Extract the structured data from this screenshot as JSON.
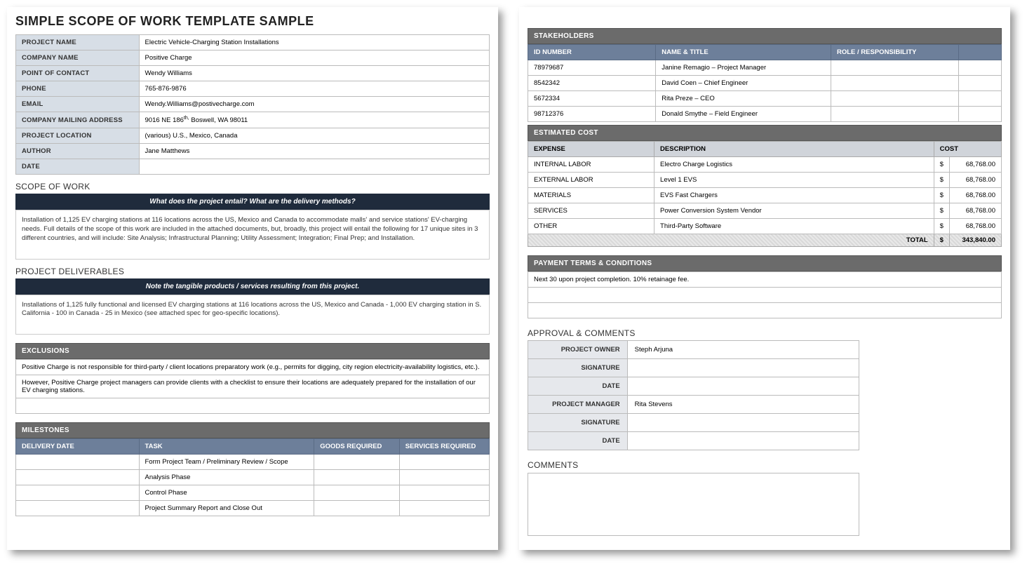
{
  "title": "SIMPLE SCOPE OF WORK TEMPLATE SAMPLE",
  "info": {
    "project_name_label": "PROJECT NAME",
    "project_name": "Electric Vehicle-Charging Station Installations",
    "company_name_label": "COMPANY NAME",
    "company_name": "Positive Charge",
    "poc_label": "POINT OF CONTACT",
    "poc": "Wendy Williams",
    "phone_label": "PHONE",
    "phone": "765-876-9876",
    "email_label": "EMAIL",
    "email": "Wendy.Williams@postivecharge.com",
    "mail_label": "COMPANY MAILING ADDRESS",
    "mail_pre": "9016 NE 186",
    "mail_sup": "th,",
    "mail_post": " Boswell, WA 98011",
    "loc_label": "PROJECT LOCATION",
    "loc": "(various) U.S., Mexico, Canada",
    "author_label": "AUTHOR",
    "author": "Jane Matthews",
    "date_label": "DATE",
    "date": ""
  },
  "scope": {
    "heading": "SCOPE OF WORK",
    "prompt": "What does the project entail? What are the delivery methods?",
    "text": "Installation of 1,125 EV charging stations at 116 locations across the US, Mexico and Canada to accommodate malls' and service stations' EV-charging needs. Full details of the scope of this work are included in the attached documents, but, broadly, this project will entail the following for 17 unique sites in 3 different countries, and will include:  Site Analysis; Infrastructural Planning; Utility Assessment; Integration; Final Prep; and Installation."
  },
  "deliverables": {
    "heading": "PROJECT DELIVERABLES",
    "prompt": "Note the tangible products / services resulting from this project.",
    "text": "Installations of 1,125 fully functional and licensed EV charging stations at 116 locations across the US, Mexico and Canada - 1,000 EV charging station in S. California - 100 in Canada - 25 in Mexico (see attached spec for geo-specific locations)."
  },
  "exclusions": {
    "heading": "EXCLUSIONS",
    "row1": "Positive Charge is not responsible for third-party / client locations preparatory work (e.g., permits for digging, city region electricity-availability logistics, etc.).",
    "row2": "However, Positive Charge project managers can provide clients with a checklist to ensure their locations are adequately prepared for the installation of our EV charging stations."
  },
  "milestones": {
    "heading": "MILESTONES",
    "cols": [
      "DELIVERY DATE",
      "TASK",
      "GOODS REQUIRED",
      "SERVICES REQUIRED"
    ],
    "rows": [
      {
        "date": "",
        "task": "Form Project Team / Preliminary Review / Scope",
        "goods": "",
        "services": ""
      },
      {
        "date": "",
        "task": "Analysis Phase",
        "goods": "",
        "services": ""
      },
      {
        "date": "",
        "task": "Control Phase",
        "goods": "",
        "services": ""
      },
      {
        "date": "",
        "task": "Project Summary Report and Close Out",
        "goods": "",
        "services": ""
      }
    ]
  },
  "stakeholders": {
    "heading": "STAKEHOLDERS",
    "cols": [
      "ID NUMBER",
      "NAME & TITLE",
      "ROLE / RESPONSIBILITY",
      ""
    ],
    "rows": [
      {
        "id": "78979687",
        "name": "Janine Remagio – Project Manager",
        "role": ""
      },
      {
        "id": "8542342",
        "name": "David Coen – Chief Engineer",
        "role": ""
      },
      {
        "id": "5672334",
        "name": "Rita Preze – CEO",
        "role": ""
      },
      {
        "id": "98712376",
        "name": "Donald Smythe – Field Engineer",
        "role": ""
      }
    ]
  },
  "costs": {
    "heading": "ESTIMATED COST",
    "cols": [
      "EXPENSE",
      "DESCRIPTION",
      "COST"
    ],
    "rows": [
      {
        "expense": "INTERNAL LABOR",
        "desc": "Electro Charge Logistics",
        "cost": "68,768.00"
      },
      {
        "expense": "EXTERNAL LABOR",
        "desc": "Level 1 EVS",
        "cost": "68,768.00"
      },
      {
        "expense": "MATERIALS",
        "desc": "EVS Fast Chargers",
        "cost": "68,768.00"
      },
      {
        "expense": "SERVICES",
        "desc": "Power Conversion System Vendor",
        "cost": "68,768.00"
      },
      {
        "expense": "OTHER",
        "desc": "Third-Party Software",
        "cost": "68,768.00"
      }
    ],
    "total_label": "TOTAL",
    "total": "343,840.00"
  },
  "payment": {
    "heading": "PAYMENT TERMS & CONDITIONS",
    "text": "Next 30 upon project completion. 10% retainage fee."
  },
  "approval": {
    "heading": "APPROVAL & COMMENTS",
    "owner_label": "PROJECT OWNER",
    "owner": "Steph Arjuna",
    "sig_label": "SIGNATURE",
    "date_label": "DATE",
    "mgr_label": "PROJECT MANAGER",
    "mgr": "Rita Stevens"
  },
  "comments_heading": "COMMENTS"
}
